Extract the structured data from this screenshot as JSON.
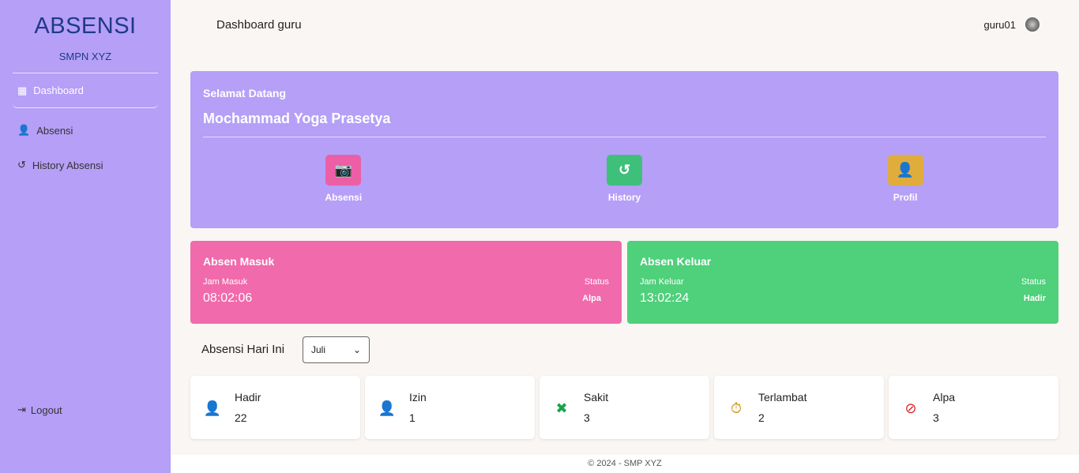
{
  "sidebar": {
    "brand": "ABSENSI",
    "school": "SMPN XYZ",
    "items": [
      {
        "label": "Dashboard"
      },
      {
        "label": "Absensi"
      },
      {
        "label": "History Absensi"
      }
    ],
    "logout": "Logout"
  },
  "header": {
    "title": "Dashboard guru",
    "username": "guru01"
  },
  "welcome": {
    "greeting": "Selamat Datang",
    "name": "Mochammad Yoga Prasetya",
    "actions": [
      {
        "label": "Absensi",
        "color": "#ec5fa6"
      },
      {
        "label": "History",
        "color": "#3fc07a"
      },
      {
        "label": "Profil",
        "color": "#e0ad3c"
      }
    ]
  },
  "masuk": {
    "title": "Absen Masuk",
    "time_label": "Jam Masuk",
    "status_label": "Status",
    "time": "08:02:06",
    "status": "Alpa",
    "color": "#f06aac"
  },
  "keluar": {
    "title": "Absen Keluar",
    "time_label": "Jam Keluar",
    "status_label": "Status",
    "time": "13:02:24",
    "status": "Hadir",
    "color": "#4fd07b"
  },
  "today": {
    "title": "Absensi Hari Ini",
    "month": "Juli"
  },
  "stats": [
    {
      "label": "Hadir",
      "value": "22"
    },
    {
      "label": "Izin",
      "value": "1"
    },
    {
      "label": "Sakit",
      "value": "3"
    },
    {
      "label": "Terlambat",
      "value": "2"
    },
    {
      "label": "Alpa",
      "value": "3"
    }
  ],
  "footer": "© 2024 - SMP XYZ"
}
